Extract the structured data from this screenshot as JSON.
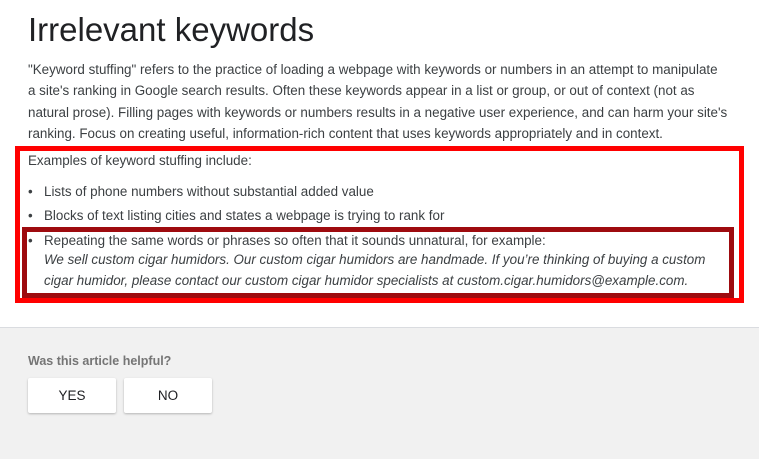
{
  "article": {
    "title": "Irrelevant keywords",
    "intro": "\"Keyword stuffing\" refers to the practice of loading a webpage with keywords or numbers in an attempt to manipulate a site's ranking in Google search results. Often these keywords appear in a list or group, or out of context (not as natural prose). Filling pages with keywords or numbers results in a negative user experience, and can harm your site's ranking. Focus on creating useful, information-rich content that uses keywords appropriately and in context.",
    "examples_heading": "Examples of keyword stuffing include:",
    "bullet_glyph": "•",
    "examples": [
      "Lists of phone numbers without substantial added value",
      "Blocks of text listing cities and states a webpage is trying to rank for",
      "Repeating the same words or phrases so often that it sounds unnatural, for example:"
    ],
    "example_quote": "We sell custom cigar humidors. Our custom cigar humidors are handmade. If you’re thinking of buying a custom cigar humidor, please contact our custom cigar humidor specialists at custom.cigar.humidors@example.com."
  },
  "feedback": {
    "question": "Was this article helpful?",
    "yes_label": "YES",
    "no_label": "NO"
  },
  "colors": {
    "highlight_outer": "#ff0000",
    "highlight_inner": "#9e0b0f",
    "text": "#3c4043",
    "feedback_bg": "#f1f1f1"
  }
}
